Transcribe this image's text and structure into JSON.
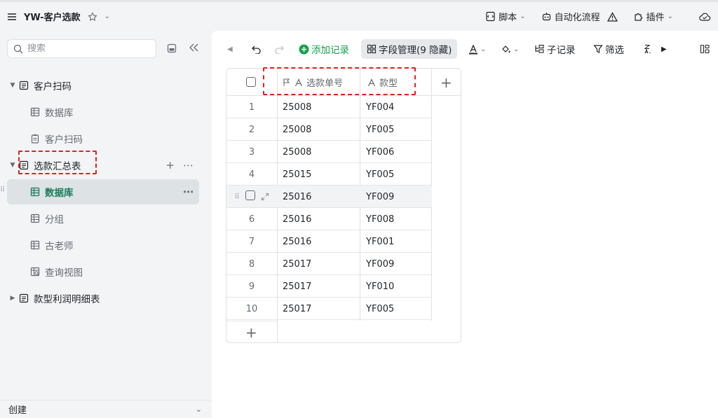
{
  "app": {
    "title": "YW-客户选款",
    "menu_icon": "hamburger-icon",
    "star_icon": "star-icon"
  },
  "topbar": {
    "script_label": "脚本",
    "automation_label": "自动化流程",
    "plugins_label": "插件"
  },
  "sidebar": {
    "search_placeholder": "搜索",
    "tree": [
      {
        "label": "客户扫码",
        "level": 0,
        "type": "doc",
        "expanded": true
      },
      {
        "label": "数据库",
        "level": 1,
        "type": "table"
      },
      {
        "label": "客户扫码",
        "level": 1,
        "type": "form"
      },
      {
        "label": "选款汇总表",
        "level": 0,
        "type": "doc",
        "expanded": true
      },
      {
        "label": "数据库",
        "level": 1,
        "type": "table",
        "active": true
      },
      {
        "label": "分组",
        "level": 1,
        "type": "table"
      },
      {
        "label": "古老师",
        "level": 1,
        "type": "table"
      },
      {
        "label": "查询视图",
        "level": 1,
        "type": "query"
      },
      {
        "label": "款型利润明细表",
        "level": 0,
        "type": "doc",
        "expanded": false
      }
    ],
    "footer_label": "创建"
  },
  "toolbar": {
    "add_record_label": "添加记录",
    "field_manage_label": "字段管理(9 隐藏)",
    "subrecord_label": "子记录",
    "filter_label": "筛选"
  },
  "grid": {
    "columns": [
      "选款单号",
      "款型"
    ],
    "rows": [
      {
        "idx": "1",
        "order": "25008",
        "style": "YF004"
      },
      {
        "idx": "2",
        "order": "25008",
        "style": "YF005"
      },
      {
        "idx": "3",
        "order": "25008",
        "style": "YF006"
      },
      {
        "idx": "4",
        "order": "25015",
        "style": "YF005"
      },
      {
        "idx": "",
        "order": "25016",
        "style": "YF009"
      },
      {
        "idx": "6",
        "order": "25016",
        "style": "YF008"
      },
      {
        "idx": "7",
        "order": "25016",
        "style": "YF001"
      },
      {
        "idx": "8",
        "order": "25017",
        "style": "YF009"
      },
      {
        "idx": "9",
        "order": "25017",
        "style": "YF010"
      },
      {
        "idx": "10",
        "order": "25017",
        "style": "YF005"
      }
    ]
  },
  "colors": {
    "accent_green": "#1a7a5a",
    "add_green": "#16a34a",
    "annotation_red": "#e02020"
  }
}
